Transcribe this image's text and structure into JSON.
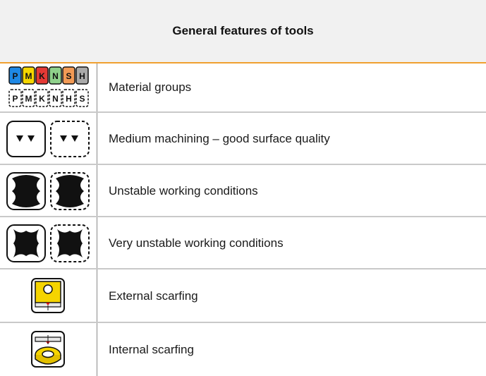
{
  "header": {
    "title": "General features of tools"
  },
  "rows": [
    {
      "label": "Material groups",
      "icon": "material-groups-icon"
    },
    {
      "label": "Medium machining – good surface quality",
      "icon": "medium-machining-icon"
    },
    {
      "label": "Unstable working conditions",
      "icon": "unstable-conditions-icon"
    },
    {
      "label": "Very unstable working conditions",
      "icon": "very-unstable-conditions-icon"
    },
    {
      "label": "External scarfing",
      "icon": "external-scarfing-icon"
    },
    {
      "label": "Internal scarfing",
      "icon": "internal-scarfing-icon"
    }
  ],
  "material_groups": {
    "top": [
      "P",
      "M",
      "K",
      "N",
      "S",
      "H"
    ],
    "bottom": [
      "P",
      "M",
      "K",
      "N",
      "H",
      "S"
    ],
    "colors": {
      "P": "#1e88e5",
      "M": "#f5d600",
      "K": "#e53935",
      "N": "#8fd18b",
      "S": "#f29a55",
      "H": "#a9a9a9"
    }
  },
  "colors": {
    "header_rule": "#f0a030",
    "scarf_yellow": "#f5d400",
    "scarf_red": "#cc1111"
  }
}
